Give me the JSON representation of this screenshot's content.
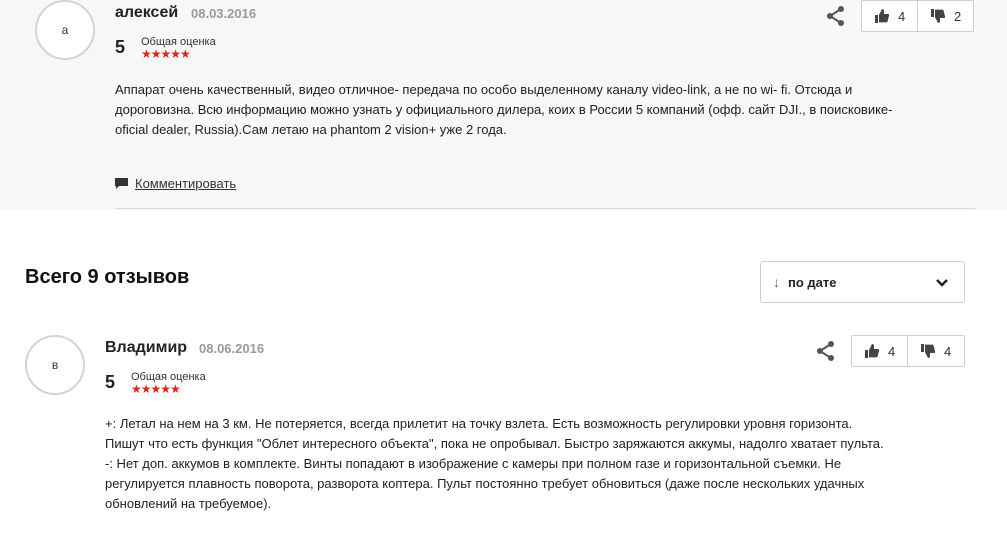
{
  "review1": {
    "avatar_letter": "а",
    "author": "алексей",
    "date": "08.03.2016",
    "score": "5",
    "score_label": "Общая оценка",
    "stars": "★★★★★",
    "text": "Аппарат очень качественный, видео отличное- передача по особо выделенному каналу video-link, а не по wi- fi. Отсюда и дороговизна. Всю информацию можно узнать у официального дилера, коих в России 5 компаний (офф. сайт DJI., в поисковике- oficial dealer, Russia).Сам летаю на phantom 2 vision+ уже 2 года.",
    "likes": "4",
    "dislikes": "2",
    "comment_label": "Комментировать"
  },
  "reviews_heading": "Всего 9 отзывов",
  "sort": {
    "arrow": "↓",
    "label": "по дате"
  },
  "review2": {
    "avatar_letter": "в",
    "author": "Владимир",
    "date": "08.06.2016",
    "score": "5",
    "score_label": "Общая оценка",
    "stars": "★★★★★",
    "text": "+: Летал на нем на 3 км. Не потеряется, всегда прилетит на точку взлета. Есть возможность регулировки уровня горизонта. Пишут что есть функция \"Облет интересного объекта\", пока не опробывал. Быстро заряжаются аккумы, надолго хватает пульта. -: Нет доп. аккумов в комплекте. Винты попадают в изображение с камеры при полном газе и горизонтальной съемки. Не регулируется плавность поворота, разворота коптера. Пульт постоянно требует обновиться (даже после нескольких удачных обновлений на требуемое).",
    "likes": "4",
    "dislikes": "4"
  },
  "colors": {
    "star": "#e2231a",
    "top_bg": "#f7f7f7",
    "border": "#cfcfcf"
  }
}
